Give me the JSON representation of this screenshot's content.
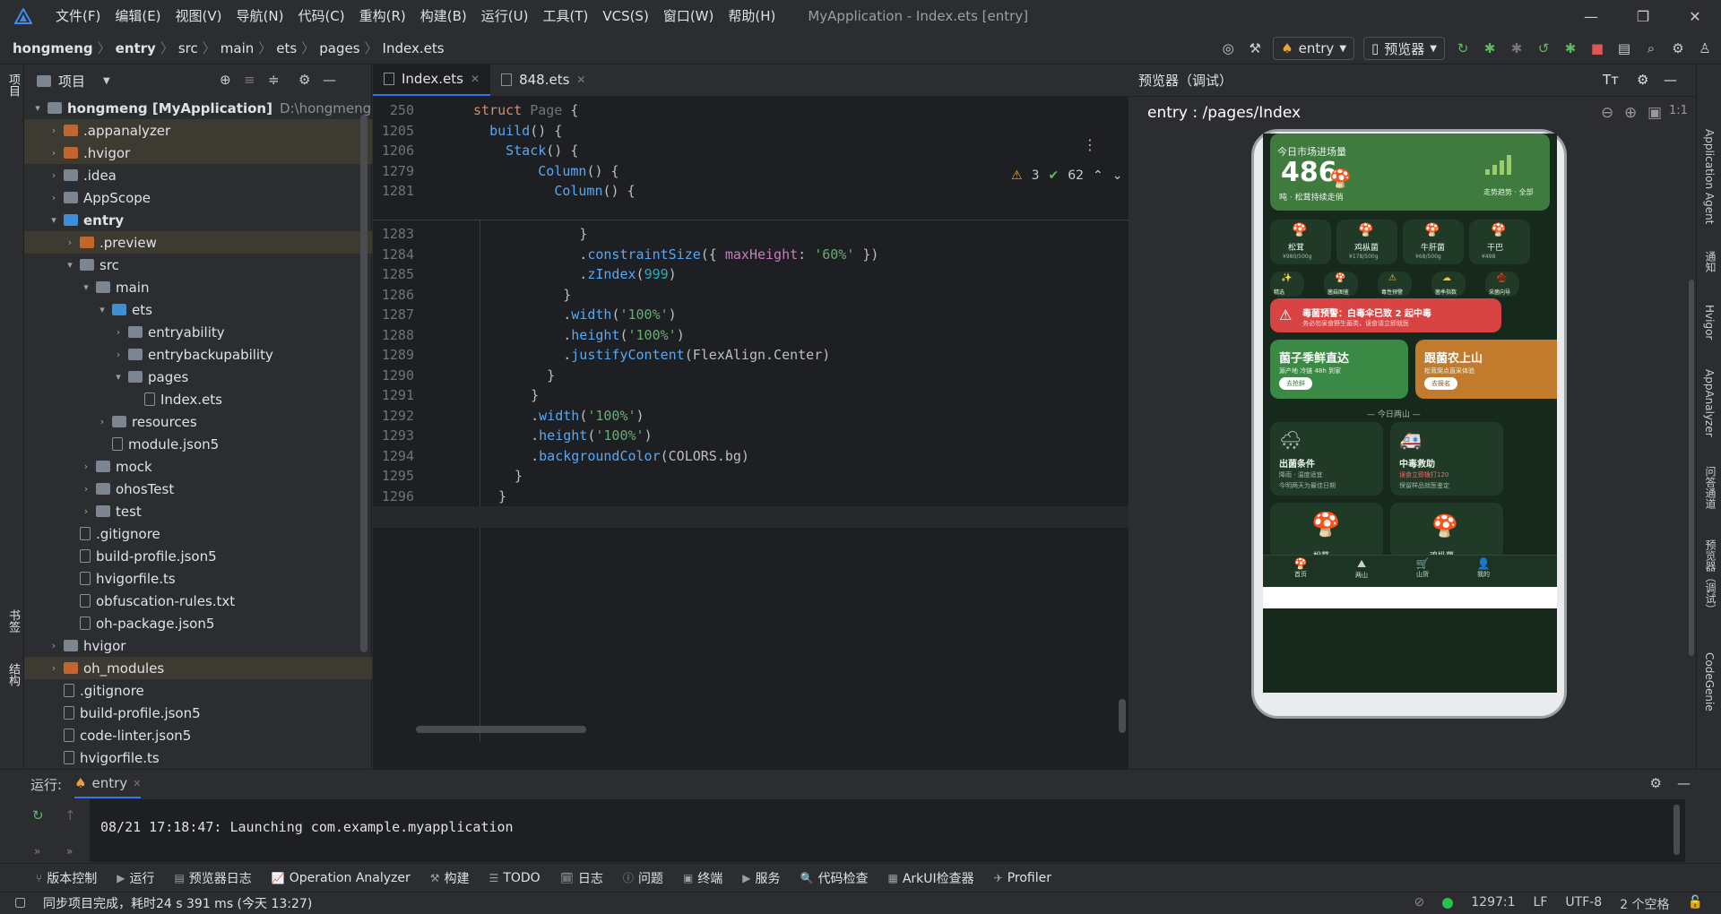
{
  "menu": [
    "文件(F)",
    "编辑(E)",
    "视图(V)",
    "导航(N)",
    "代码(C)",
    "重构(R)",
    "构建(B)",
    "运行(U)",
    "工具(T)",
    "VCS(S)",
    "窗口(W)",
    "帮助(H)"
  ],
  "window_title": "MyApplication - Index.ets [entry]",
  "breadcrumb": [
    "hongmeng",
    "entry",
    "src",
    "main",
    "ets",
    "pages",
    "Index.ets"
  ],
  "nav": {
    "module": "entry",
    "device": "预览器"
  },
  "project": {
    "title": "项目",
    "tree": [
      {
        "level": 0,
        "arrow": "▾",
        "type": "fold",
        "label": "hongmeng [MyApplication]",
        "sub": "D:\\hongmeng"
      },
      {
        "level": 1,
        "arrow": "›",
        "type": "orange",
        "label": ".appanalyzer"
      },
      {
        "level": 1,
        "arrow": "›",
        "type": "orange",
        "label": ".hvigor"
      },
      {
        "level": 1,
        "arrow": "›",
        "type": "fold",
        "label": ".idea"
      },
      {
        "level": 1,
        "arrow": "›",
        "type": "fold",
        "label": "AppScope"
      },
      {
        "level": 1,
        "arrow": "▾",
        "type": "blue",
        "label": "entry"
      },
      {
        "level": 2,
        "arrow": "›",
        "type": "orange",
        "label": ".preview"
      },
      {
        "level": 2,
        "arrow": "▾",
        "type": "fold",
        "label": "src"
      },
      {
        "level": 3,
        "arrow": "▾",
        "type": "fold",
        "label": "main"
      },
      {
        "level": 4,
        "arrow": "▾",
        "type": "blue",
        "label": "ets"
      },
      {
        "level": 5,
        "arrow": "›",
        "type": "fold",
        "label": "entryability"
      },
      {
        "level": 5,
        "arrow": "›",
        "type": "fold",
        "label": "entrybackupability"
      },
      {
        "level": 5,
        "arrow": "▾",
        "type": "fold",
        "label": "pages"
      },
      {
        "level": 6,
        "arrow": "",
        "type": "file",
        "label": "Index.ets"
      },
      {
        "level": 4,
        "arrow": "›",
        "type": "fold",
        "label": "resources"
      },
      {
        "level": 4,
        "arrow": "",
        "type": "file",
        "label": "module.json5"
      },
      {
        "level": 3,
        "arrow": "›",
        "type": "fold",
        "label": "mock"
      },
      {
        "level": 3,
        "arrow": "›",
        "type": "fold",
        "label": "ohosTest"
      },
      {
        "level": 3,
        "arrow": "›",
        "type": "fold",
        "label": "test"
      },
      {
        "level": 2,
        "arrow": "",
        "type": "file",
        "label": ".gitignore"
      },
      {
        "level": 2,
        "arrow": "",
        "type": "file",
        "label": "build-profile.json5"
      },
      {
        "level": 2,
        "arrow": "",
        "type": "file",
        "label": "hvigorfile.ts"
      },
      {
        "level": 2,
        "arrow": "",
        "type": "file",
        "label": "obfuscation-rules.txt"
      },
      {
        "level": 2,
        "arrow": "",
        "type": "file",
        "label": "oh-package.json5"
      },
      {
        "level": 1,
        "arrow": "›",
        "type": "fold",
        "label": "hvigor"
      },
      {
        "level": 1,
        "arrow": "›",
        "type": "orange",
        "label": "oh_modules"
      },
      {
        "level": 1,
        "arrow": "",
        "type": "file",
        "label": ".gitignore"
      },
      {
        "level": 1,
        "arrow": "",
        "type": "file",
        "label": "build-profile.json5"
      },
      {
        "level": 1,
        "arrow": "",
        "type": "file",
        "label": "code-linter.json5"
      },
      {
        "level": 1,
        "arrow": "",
        "type": "file",
        "label": "hvigorfile.ts"
      }
    ]
  },
  "editor": {
    "tabs": [
      "Index.ets",
      "848.ets"
    ],
    "warnings": "3",
    "checks": "62",
    "sticky": [
      {
        "ln": "250",
        "code": "struct Page {"
      },
      {
        "ln": "1205",
        "code": "  build() {"
      },
      {
        "ln": "1206",
        "code": "    Stack() {"
      },
      {
        "ln": "1279",
        "code": "        Column() {"
      },
      {
        "ln": "1281",
        "code": "          Column() {"
      }
    ],
    "lines": [
      {
        "ln": "1283",
        "code": "          }"
      },
      {
        "ln": "1284",
        "code": "          .constraintSize({ maxHeight: '60%' })"
      },
      {
        "ln": "1285",
        "code": "          .zIndex(999)"
      },
      {
        "ln": "1286",
        "code": "        }"
      },
      {
        "ln": "1287",
        "code": "        .width('100%')"
      },
      {
        "ln": "1288",
        "code": "        .height('100%')"
      },
      {
        "ln": "1289",
        "code": "        .justifyContent(FlexAlign.Center)"
      },
      {
        "ln": "1290",
        "code": "      }"
      },
      {
        "ln": "1291",
        "code": "    }"
      },
      {
        "ln": "1292",
        "code": "    .width('100%')"
      },
      {
        "ln": "1293",
        "code": "    .height('100%')"
      },
      {
        "ln": "1294",
        "code": "    .backgroundColor(COLORS.bg)"
      },
      {
        "ln": "1295",
        "code": "  }"
      },
      {
        "ln": "1296",
        "code": "}"
      },
      {
        "ln": "1297",
        "code": ""
      }
    ]
  },
  "preview": {
    "title": "预览器（调试）",
    "path": "entry : /pages/Index",
    "app": {
      "banner_title": "今日市场进场量",
      "banner_value": "486",
      "banner_sub": "吨 · 松茸持续走俏",
      "banner_right": "走势趋势 · 全部",
      "items": [
        {
          "name": "松茸",
          "price": "¥980/500g"
        },
        {
          "name": "鸡枞菌",
          "price": "¥178/500g"
        },
        {
          "name": "牛肝菌",
          "price": "¥68/500g"
        },
        {
          "name": "干巴",
          "price": "¥498"
        }
      ],
      "shortcuts": [
        "精选",
        "菌菇图鉴",
        "毒性预警",
        "菌季指数",
        "采菌向导"
      ],
      "alert_title": "毒菌预警：白毒伞已致 2 起中毒",
      "alert_sub": "务必勿采食野生菌类，误食请立即就医",
      "promo1_title": "菌子季鲜直达",
      "promo1_sub": "源产地 冷链 48h 到家",
      "promo1_btn": "去抢鲜",
      "promo2_title": "跟菌农上山",
      "promo2_sub": "松茸窝点直采体验",
      "promo2_btn": "去报名",
      "divider": "— 今日两山 —",
      "card1_title": "出菌条件",
      "card1_sub": "降雨 · 温度适宜",
      "card1_sub2": "今明两天为最佳日期",
      "card2_title": "中毒救助",
      "card2_sub": "误食立即拨打120",
      "card2_sub2": "保留样品就医鉴定",
      "card3_label": "松茸",
      "card4_label": "鸡枞菌",
      "tabs": [
        "首页",
        "两山",
        "山货",
        "我的"
      ]
    }
  },
  "run": {
    "label": "运行:",
    "config": "entry",
    "console": "08/21 17:18:47: Launching com.example.myapplication"
  },
  "toolwindows": [
    "版本控制",
    "运行",
    "预览器日志",
    "Operation Analyzer",
    "构建",
    "TODO",
    "日志",
    "问题",
    "终端",
    "服务",
    "代码检查",
    "ArkUI检查器",
    "Profiler"
  ],
  "status": {
    "message": "同步项目完成，耗时24 s 391 ms (今天 13:27)",
    "position": "1297:1",
    "line_sep": "LF",
    "encoding": "UTF-8",
    "indent": "2 个空格"
  },
  "left_strip": [
    "项目",
    "书签",
    "结构"
  ],
  "right_strip": [
    "Application Agent",
    "通知",
    "Hvigor",
    "AppAnalyzer",
    "问答通道",
    "预览器（调试）",
    "CodeGenie"
  ],
  "colors": {
    "accent": "#3574f0",
    "alert": "#e53935",
    "green_card": "#2e7d32",
    "orange_card": "#c27a2c"
  }
}
